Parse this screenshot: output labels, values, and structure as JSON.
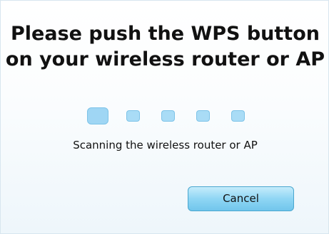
{
  "dialog": {
    "title": "Please push the WPS button on your wireless router or AP",
    "status_text": "Scanning the wireless router or AP",
    "cancel_label": "Cancel",
    "progress": {
      "total_steps": 5,
      "active_step": 1
    }
  },
  "colors": {
    "background_top": "#ffffff",
    "background_bottom": "#eef6fb",
    "progress_dot": "#a9dcf6",
    "button_fill": "#8fd6f4",
    "button_border": "#4aa7cf",
    "text": "#111111"
  }
}
